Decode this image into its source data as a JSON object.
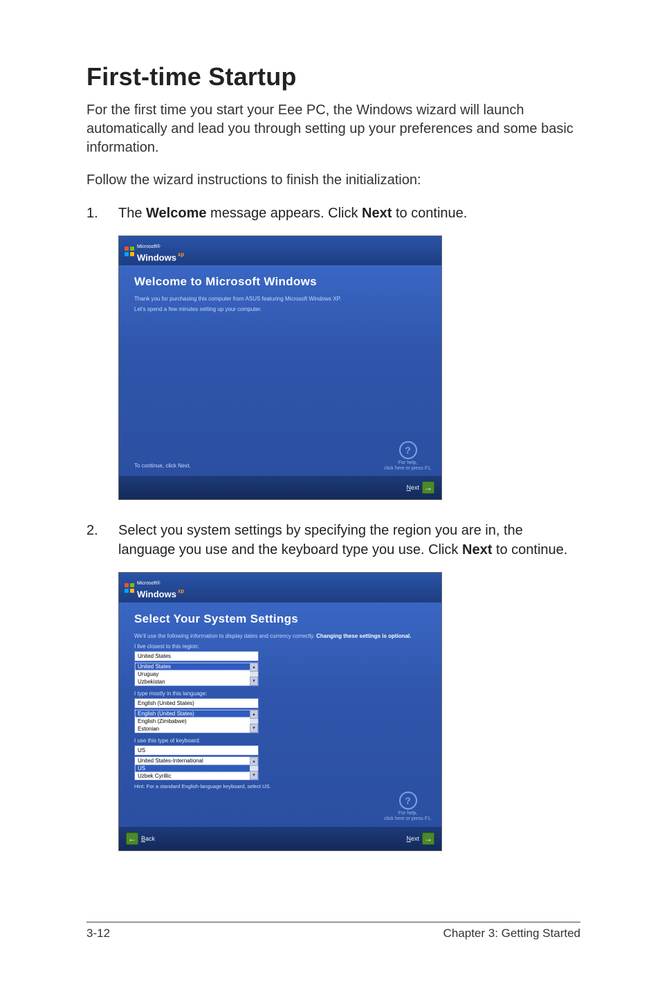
{
  "page": {
    "title": "First-time Startup",
    "intro": "For the first time you start your Eee PC, the Windows wizard will launch automatically and lead you through setting up your preferences and some basic information.",
    "follow": "Follow the wizard instructions to finish the initialization:",
    "footer_left": "3-12",
    "footer_right": "Chapter 3: Getting Started"
  },
  "steps": {
    "s1": {
      "num": "1.",
      "pre": "The ",
      "bold1": "Welcome",
      "mid": " message appears. Click ",
      "bold2": "Next",
      "post": " to continue."
    },
    "s2": {
      "num": "2.",
      "pre": "Select you system settings by specifying the region you are in, the language you use and the keyboard type you use. Click ",
      "bold1": "Next",
      "post": " to continue."
    }
  },
  "brand": {
    "ms": "Microsoft®",
    "win": "Windows",
    "xp": "xp"
  },
  "shot1": {
    "title": "Welcome to Microsoft Windows",
    "line1": "Thank you for purchasing this computer from ASUS featuring Microsoft Windows XP.",
    "line2": "Let's spend a few minutes setting up your computer.",
    "cont": "To continue, click Next.",
    "help1": "For help,",
    "help2": "click here or press F1.",
    "help_icon": "?",
    "next_u": "N",
    "next_rest": "ext"
  },
  "shot2": {
    "title": "Select Your System Settings",
    "sub_a": "We'll use the following information to display dates and currency correctly. ",
    "sub_b": "Changing these settings is optional.",
    "region_label": "I live closest to this region:",
    "region_sel": "United States",
    "region_opts": [
      "United States",
      "Uruguay",
      "Uzbekistan"
    ],
    "lang_label": "I type mostly in this language:",
    "lang_sel": "English (United States)",
    "lang_opts": [
      "English (United States)",
      "English (Zimbabwe)",
      "Estonian"
    ],
    "kb_label": "I use this type of keyboard:",
    "kb_sel": "US",
    "kb_opts": [
      "United States-International",
      "US",
      "Uzbek Cyrillic"
    ],
    "kb_hint": "Hint: For a standard English-language keyboard, select US.",
    "help1": "For help,",
    "help2": "click here or press F1.",
    "help_icon": "?",
    "back_u": "B",
    "back_rest": "ack",
    "next_u": "N",
    "next_rest": "ext",
    "scroll_up": "▴",
    "scroll_down": "▾"
  }
}
